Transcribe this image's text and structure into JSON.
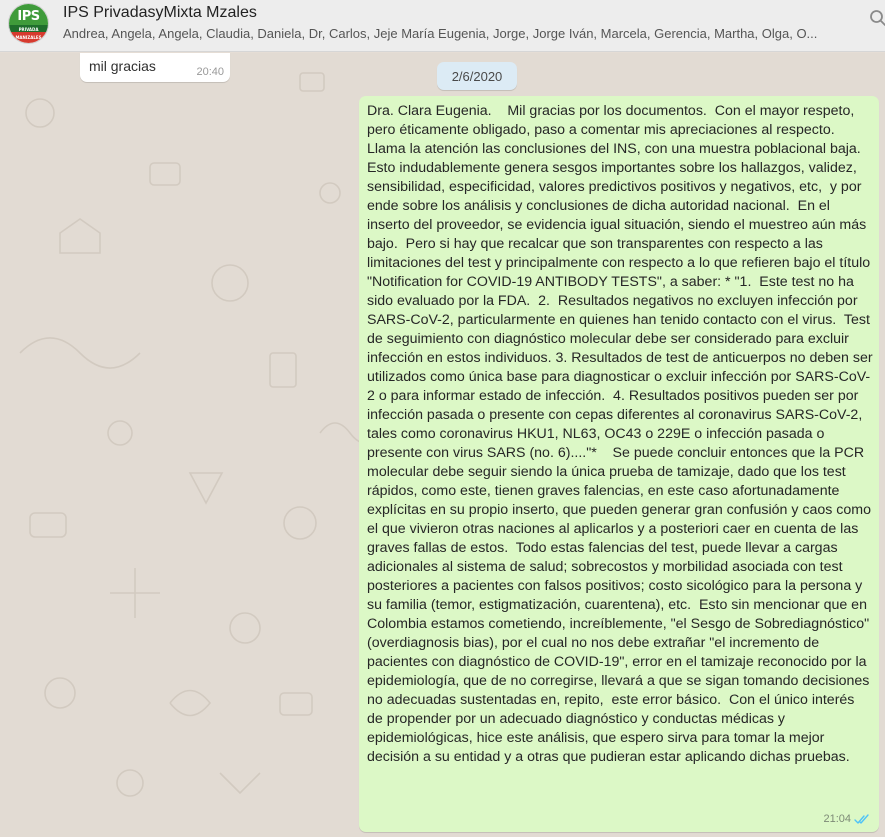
{
  "header": {
    "group_name": "IPS PrivadasyMixta Mzales",
    "members": "Andrea, Angela, Angela, Claudia, Daniela, Dr, Carlos, Jeje María Eugenia, Jorge, Jorge Iván, Marcela, Gerencia, Martha, Olga, O...",
    "avatar_logo_text": "IPS",
    "avatar_logo_sub_a": "PRIVADA",
    "avatar_logo_sub_b": "MANIZALES"
  },
  "colors": {
    "incoming_bubble": "#ffffff",
    "outgoing_bubble": "#dcf8c6",
    "date_chip": "#dcebf5",
    "read_ticks": "#4fc3f7",
    "chat_background": "#e2dbd3"
  },
  "icons": {
    "search": "search-icon",
    "read_status": "double-check-icon"
  },
  "messages": [
    {
      "direction": "incoming",
      "text": "mil gracias",
      "time": "20:40"
    },
    {
      "direction": "date-separator",
      "text": "2/6/2020"
    },
    {
      "direction": "outgoing",
      "text": "Dra. Clara Eugenia.    Mil gracias por los documentos.  Con el mayor respeto, pero éticamente obligado, paso a comentar mis apreciaciones al respecto.  Llama la atención las conclusiones del INS, con una muestra poblacional baja.   Esto indudablemente genera sesgos importantes sobre los hallazgos, validez, sensibilidad, especificidad, valores predictivos positivos y negativos, etc,  y por ende sobre los análisis y conclusiones de dicha autoridad nacional.  En el inserto del proveedor, se evidencia igual situación, siendo el muestreo aún más bajo.  Pero si hay que recalcar que son transparentes con respecto a las limitaciones del test y principalmente con respecto a lo que refieren bajo el título \"Notification for COVID-19 ANTIBODY TESTS\", a saber: * \"1.  Este test no ha sido evaluado por la FDA.  2.  Resultados negativos no excluyen infección por SARS-CoV-2, particularmente en quienes han tenido contacto con el virus.  Test de seguimiento con diagnóstico molecular debe ser considerado para excluir infección en estos individuos. 3. Resultados de test de anticuerpos no deben ser utilizados como única base para diagnosticar o excluir infección por SARS-CoV-2 o para informar estado de infección.  4. Resultados positivos pueden ser por infección pasada o presente con cepas diferentes al coronavirus SARS-CoV-2, tales como coronavirus HKU1, NL63, OC43 o 229E o infección pasada o presente con virus SARS (no. 6)....\"*    Se puede concluir entonces que la PCR molecular debe seguir siendo la única prueba de tamizaje, dado que los test rápidos, como este, tienen graves falencias, en este caso afortunadamente explícitas en su propio inserto, que pueden generar gran confusión y caos como el que vivieron otras naciones al aplicarlos y a posteriori caer en cuenta de las graves fallas de estos.  Todo estas falencias del test, puede llevar a cargas adicionales al sistema de salud; sobrecostos y morbilidad asociada con test posteriores a pacientes con falsos positivos; costo sicológico para la persona y su familia (temor, estigmatización, cuarentena), etc.  Esto sin mencionar que en Colombia estamos cometiendo, increíblemente, \"el Sesgo de Sobrediagnóstico\" (overdiagnosis bias), por el cual no nos debe extrañar \"el incremento de pacientes con diagnóstico de COVID-19\", error en el tamizaje reconocido por la epidemiología, que de no corregirse, llevará a que se sigan tomando decisiones no adecuadas sustentadas en, repito,  este error básico.  Con el único interés de propender por un adecuado diagnóstico y conductas médicas y epidemiológicas, hice este análisis, que espero sirva para tomar la mejor decisión a su entidad y a otras que pudieran estar aplicando dichas pruebas.",
      "time": "21:04"
    }
  ]
}
